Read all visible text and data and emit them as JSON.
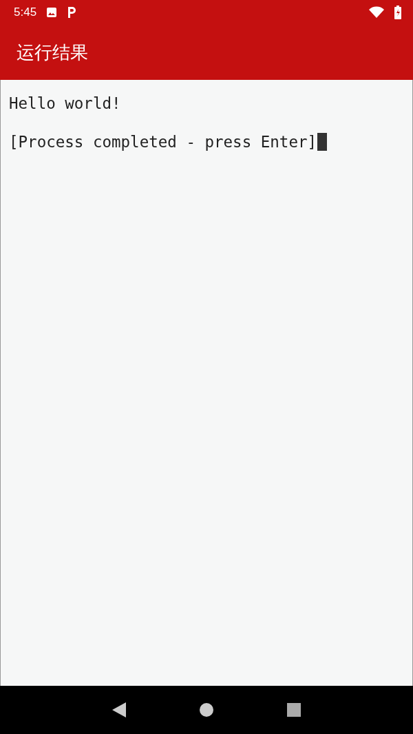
{
  "status_bar": {
    "time": "5:45"
  },
  "app_bar": {
    "title": "运行结果"
  },
  "terminal": {
    "lines": [
      "Hello world!",
      "[Process completed - press Enter]"
    ]
  }
}
